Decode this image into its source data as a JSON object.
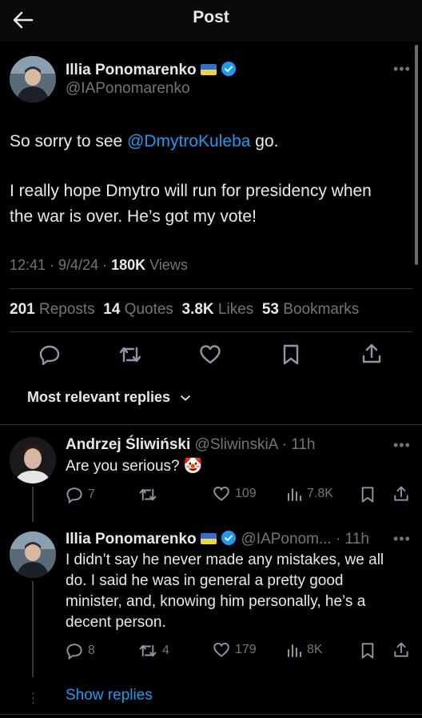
{
  "header": {
    "title": "Post"
  },
  "post": {
    "author_name": "Illia Ponomarenko",
    "author_handle": "@IAPonomarenko",
    "text_prefix": "So sorry to see ",
    "mention": "@DmytroKuleba",
    "text_suffix": " go.",
    "line2": "I really hope Dmytro will run for presidency when",
    "line3": "the war is over. He’s got my vote!",
    "time": "12:41 · 9/4/24 · ",
    "views_count": "180K",
    "views_label": " Views",
    "reposts_count": "201",
    "reposts_label": "Reposts",
    "quotes_count": "14",
    "quotes_label": "Quotes",
    "likes_count": "3.8K",
    "likes_label": "Likes",
    "bookmarks_count": "53",
    "bookmarks_label": "Bookmarks"
  },
  "sort": {
    "label": "Most relevant replies"
  },
  "replies": [
    {
      "name": "Andrzej Śliwiński",
      "handle_time": "@SliwinskiA · 11h",
      "text": "Are you serious? 🤡",
      "replies": "7",
      "reposts": "",
      "likes": "109",
      "views": "7.8K"
    },
    {
      "name": "Illia Ponomarenko",
      "handle_time": "@IAPonom... · 11h",
      "text_lines": [
        "I didn’t say he never made any mistakes, we all",
        "do. I said he was in general a pretty good",
        "minister, and, knowing him personally, he’s a",
        "decent person."
      ],
      "replies": "8",
      "reposts": "4",
      "likes": "179",
      "views": "8K"
    }
  ],
  "show_replies": "Show replies",
  "colors": {
    "accent": "#1d9bf0",
    "muted": "#71767b",
    "text": "#e7e9ea",
    "background": "#000000"
  }
}
